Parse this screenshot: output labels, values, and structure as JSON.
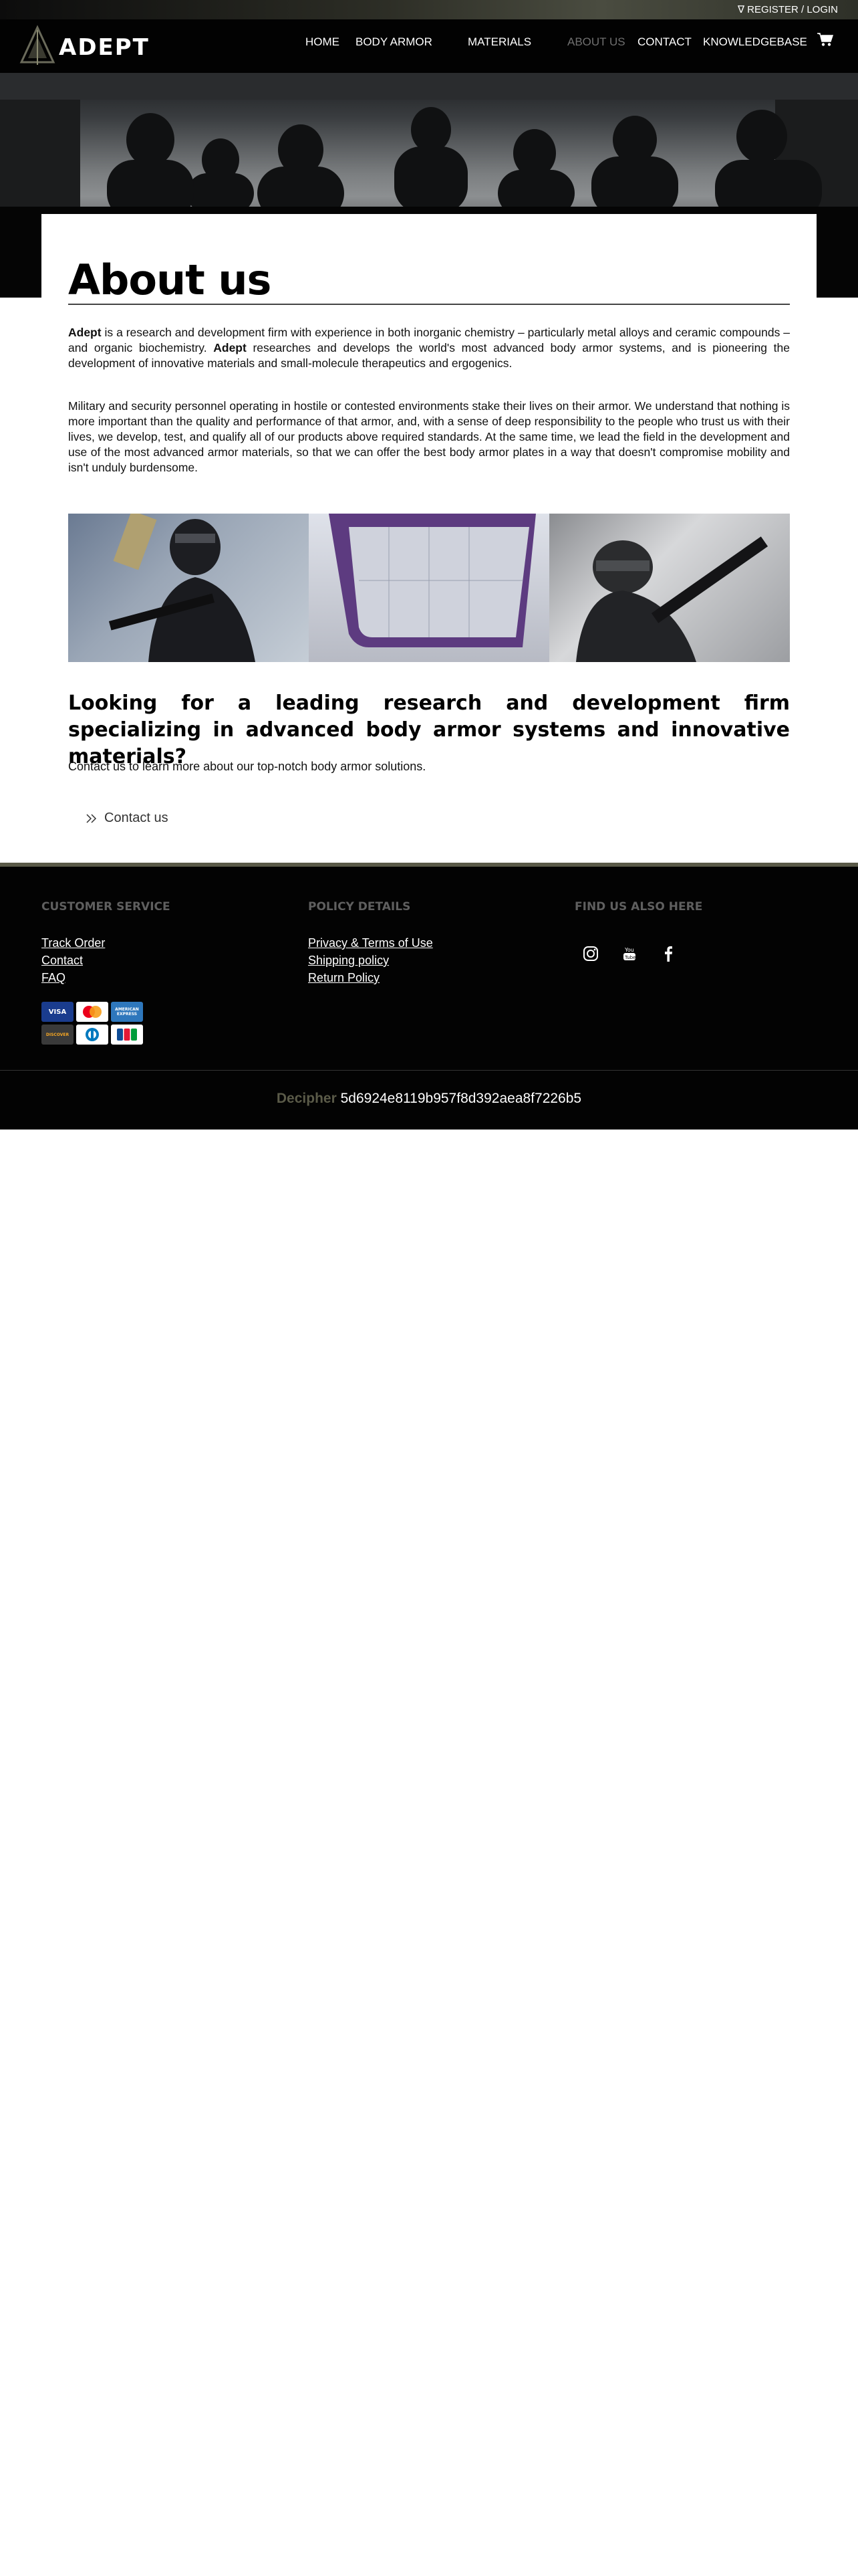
{
  "topbar": {
    "login_label": "∇ REGISTER / LOGIN"
  },
  "nav": {
    "logo_text": "ADEPT",
    "items": [
      "HOME",
      "BODY ARMOR",
      "MATERIALS",
      "ABOUT US",
      "CONTACT",
      "KNOWLEDGEBASE"
    ],
    "active": "ABOUT US"
  },
  "page": {
    "title": "About us",
    "p1_brand": "Adept",
    "p1_a": " is a research and development firm with experience in both inorganic chemistry – particularly metal alloys and ceramic compounds – and organic biochemistry.  ",
    "p1_brand2": "Adept",
    "p1_b": " researches and develops the world's most advanced body armor systems, and is pioneering the development of innovative materials and small-molecule therapeutics and ergogenics.",
    "p2": "Military and security personnel operating in hostile or contested environments stake their lives on their armor. We understand that nothing is more important than the quality and performance of that armor, and, with a sense of deep responsibility to the people who trust us with their lives, we develop, test, and qualify all of our products above required standards.  At the same time, we lead the field in the development and use of the most advanced armor materials, so that we can offer the best body armor plates in a way that doesn't compromise mobility and isn't unduly burdensome.",
    "subhead": "Looking for a leading research and development firm specializing in advanced body armor systems and innovative materials?",
    "contact_text": "Contact us to learn more about our top-notch body armor solutions.",
    "contact_link": "Contact us"
  },
  "footer": {
    "customer_service": {
      "heading": "CUSTOMER SERVICE",
      "links": [
        "Track Order",
        "Contact",
        "FAQ"
      ]
    },
    "policy": {
      "heading": "POLICY DETAILS",
      "links": [
        "Privacy & Terms of Use",
        "Shipping policy",
        "Return Policy"
      ]
    },
    "social": {
      "heading": "FIND US ALSO HERE",
      "icons": [
        "instagram-icon",
        "youtube-icon",
        "facebook-icon"
      ]
    },
    "payments": [
      "VISA",
      "mastercard",
      "AMERICAN EXPRESS",
      "DISCOVER",
      "Diners Club",
      "JCB"
    ]
  },
  "bottom": {
    "label": "Decipher",
    "hash": "5d6924e8119b957f8d392aea8f7226b5"
  },
  "colors": {
    "nav_bg": "#020202",
    "active_nav": "#707070",
    "footer_accent": "#5a5a48"
  }
}
